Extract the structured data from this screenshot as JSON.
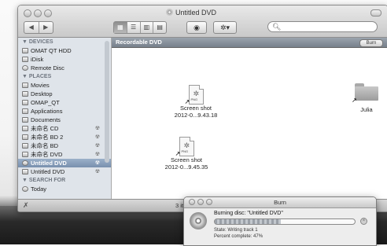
{
  "window": {
    "title": "Untitled DVD",
    "nav": {
      "back": "◀",
      "forward": "▶"
    },
    "view_buttons": [
      "▦",
      "☰",
      "▥",
      "▤"
    ],
    "eye_button": "◉",
    "action_button": "✲▾",
    "search": {
      "placeholder": "",
      "icon": "search-icon"
    }
  },
  "sidebar": {
    "sections": [
      {
        "header": "▼ DEVICES",
        "items": [
          {
            "label": "OMAT QT HDD",
            "eject": ""
          },
          {
            "label": "iDisk",
            "eject": ""
          },
          {
            "label": "Remote Disc",
            "eject": ""
          }
        ]
      },
      {
        "header": "▼ PLACES",
        "items": [
          {
            "label": "Movies",
            "eject": ""
          },
          {
            "label": "Desktop",
            "eject": ""
          },
          {
            "label": "OMAP_QT",
            "eject": ""
          },
          {
            "label": "Applications",
            "eject": ""
          },
          {
            "label": "Documents",
            "eject": ""
          },
          {
            "label": "未命名 CD",
            "eject": "☢"
          },
          {
            "label": "未命名 BD 2",
            "eject": "☢"
          },
          {
            "label": "未命名 BD",
            "eject": "☢"
          },
          {
            "label": "未命名 DVD",
            "eject": "☢"
          },
          {
            "label": "Untitled DVD",
            "eject": "☢",
            "selected": true
          },
          {
            "label": "Untitled DVD",
            "eject": "☢"
          }
        ]
      },
      {
        "header": "▼ SEARCH FOR",
        "items": [
          {
            "label": "Today",
            "eject": ""
          }
        ]
      }
    ]
  },
  "main": {
    "path_label": "Recordable DVD",
    "burn_button": "Burn",
    "files": [
      {
        "name_line1": "Screen shot",
        "name_line2": "2012-0...9.43.18",
        "kind": "PNG"
      },
      {
        "name_line1": "Screen shot",
        "name_line2": "2012-0...9.45.35",
        "kind": "PNG"
      },
      {
        "name_line1": "Julia",
        "name_line2": "",
        "kind": "folder"
      }
    ]
  },
  "status": {
    "text": "3 item",
    "lead": "✗"
  },
  "burn_dialog": {
    "title": "Burn",
    "message": "Burning disc: \"Untitled DVD\"",
    "state": "State: Writing track 1",
    "percent_text": "Percent complete: 47%",
    "progress_percent": 47,
    "stop": "×"
  }
}
